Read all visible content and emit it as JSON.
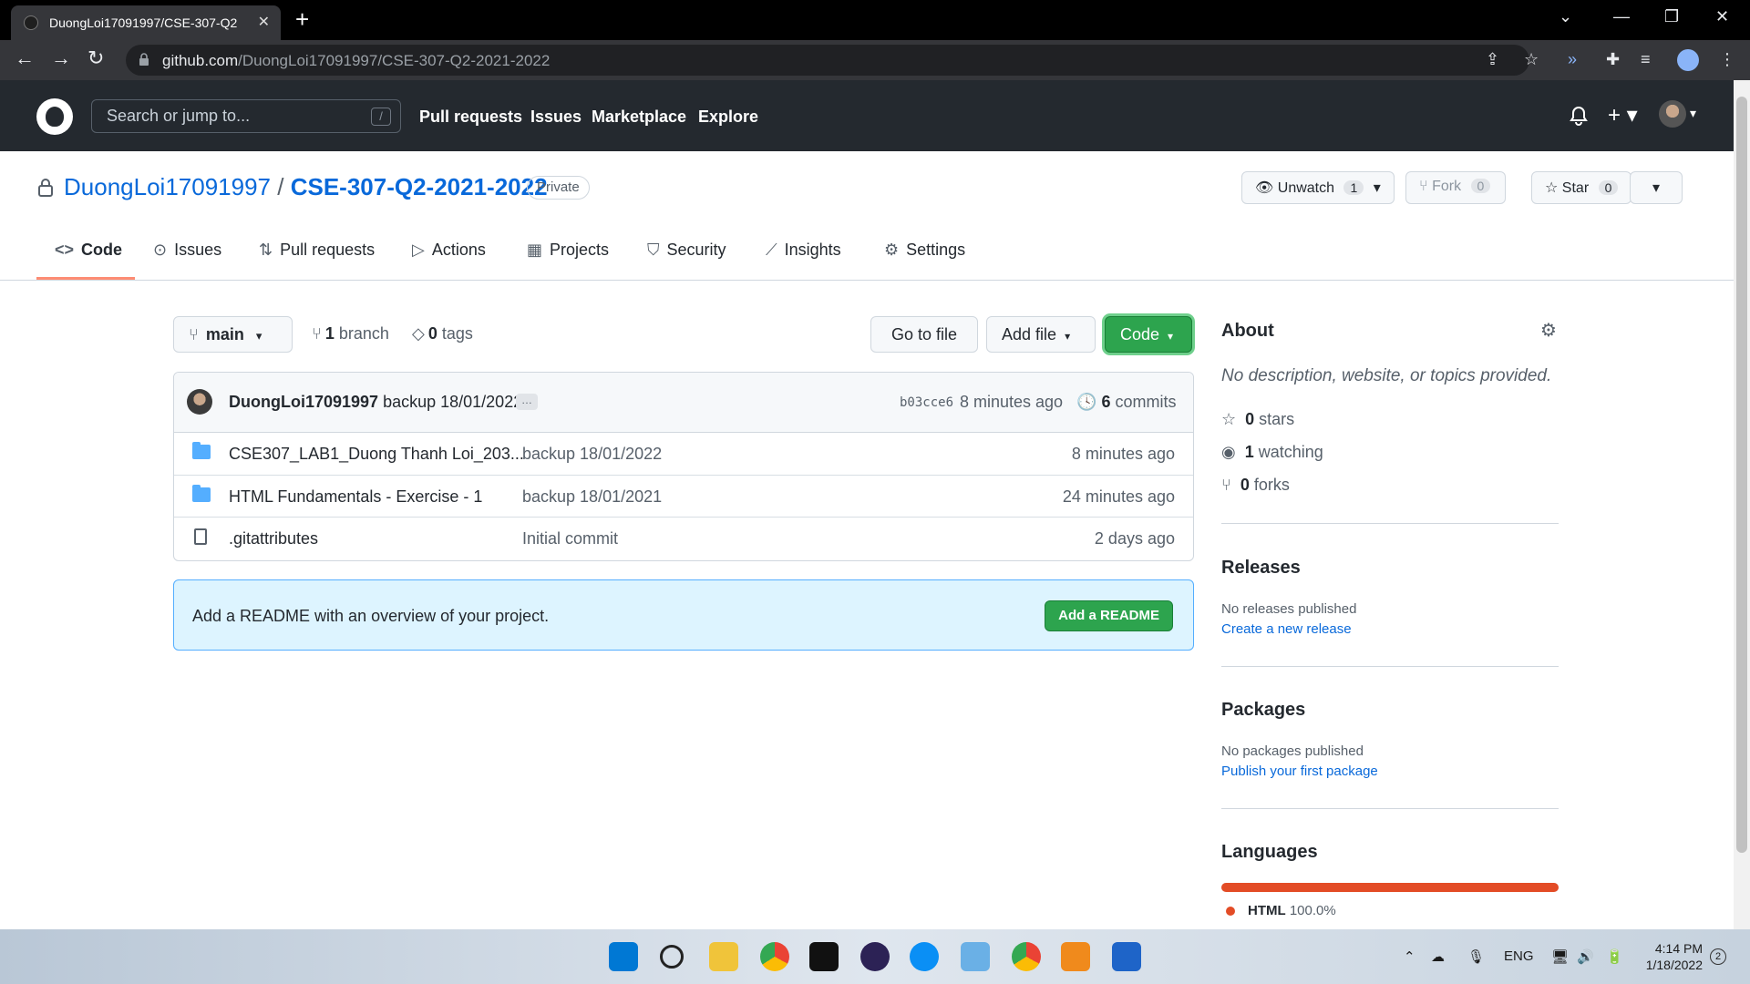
{
  "browser": {
    "tab_title": "DuongLoi17091997/CSE-307-Q2",
    "url_host": "github.com",
    "url_path": "/DuongLoi17091997/CSE-307-Q2-2021-2022"
  },
  "gh_header": {
    "search_placeholder": "Search or jump to...",
    "search_shortcut": "/",
    "nav": [
      "Pull requests",
      "Issues",
      "Marketplace",
      "Explore"
    ]
  },
  "repo": {
    "owner": "DuongLoi17091997",
    "separator": "/",
    "name": "CSE-307-Q2-2021-2022",
    "visibility": "Private",
    "unwatch_label": "Unwatch",
    "watch_count": "1",
    "fork_label": "Fork",
    "fork_count": "0",
    "star_label": "Star",
    "star_count": "0"
  },
  "tabs": [
    "Code",
    "Issues",
    "Pull requests",
    "Actions",
    "Projects",
    "Security",
    "Insights",
    "Settings"
  ],
  "branch_bar": {
    "branch": "main",
    "branch_count": "1",
    "branch_word": "branch",
    "tag_count": "0",
    "tag_word": "tags",
    "go_to_file": "Go to file",
    "add_file": "Add file",
    "code": "Code"
  },
  "commit": {
    "author": "DuongLoi17091997",
    "message": "backup 18/01/2022",
    "ellipsis": "…",
    "sha": "b03cce6",
    "time": "8 minutes ago",
    "commits_count": "6",
    "commits_word": "commits"
  },
  "files": [
    {
      "name": "CSE307_LAB1_Duong Thanh Loi_203...",
      "message": "backup 18/01/2022",
      "age": "8 minutes ago",
      "type": "folder"
    },
    {
      "name": "HTML Fundamentals - Exercise - 1",
      "message": "backup 18/01/2021",
      "age": "24 minutes ago",
      "type": "folder"
    },
    {
      "name": ".gitattributes",
      "message": "Initial commit",
      "age": "2 days ago",
      "type": "file"
    }
  ],
  "readme_banner": {
    "text": "Add a README with an overview of your project.",
    "button": "Add a README"
  },
  "about": {
    "heading": "About",
    "description": "No description, website, or topics provided.",
    "stars_count": "0",
    "stars_word": "stars",
    "watching_count": "1",
    "watching_word": "watching",
    "forks_count": "0",
    "forks_word": "forks"
  },
  "releases": {
    "heading": "Releases",
    "text": "No releases published",
    "link": "Create a new release"
  },
  "packages": {
    "heading": "Packages",
    "text": "No packages published",
    "link": "Publish your first package"
  },
  "languages": {
    "heading": "Languages",
    "name": "HTML",
    "percent": "100.0%",
    "fraction": 1.0,
    "color": "#e34c26"
  },
  "colors": {
    "accent": "#0969da",
    "green": "#2da44e",
    "header_bg": "#24292f"
  },
  "taskbar": {
    "lang": "ENG",
    "time": "4:14 PM",
    "date": "1/18/2022",
    "badge": "2"
  }
}
